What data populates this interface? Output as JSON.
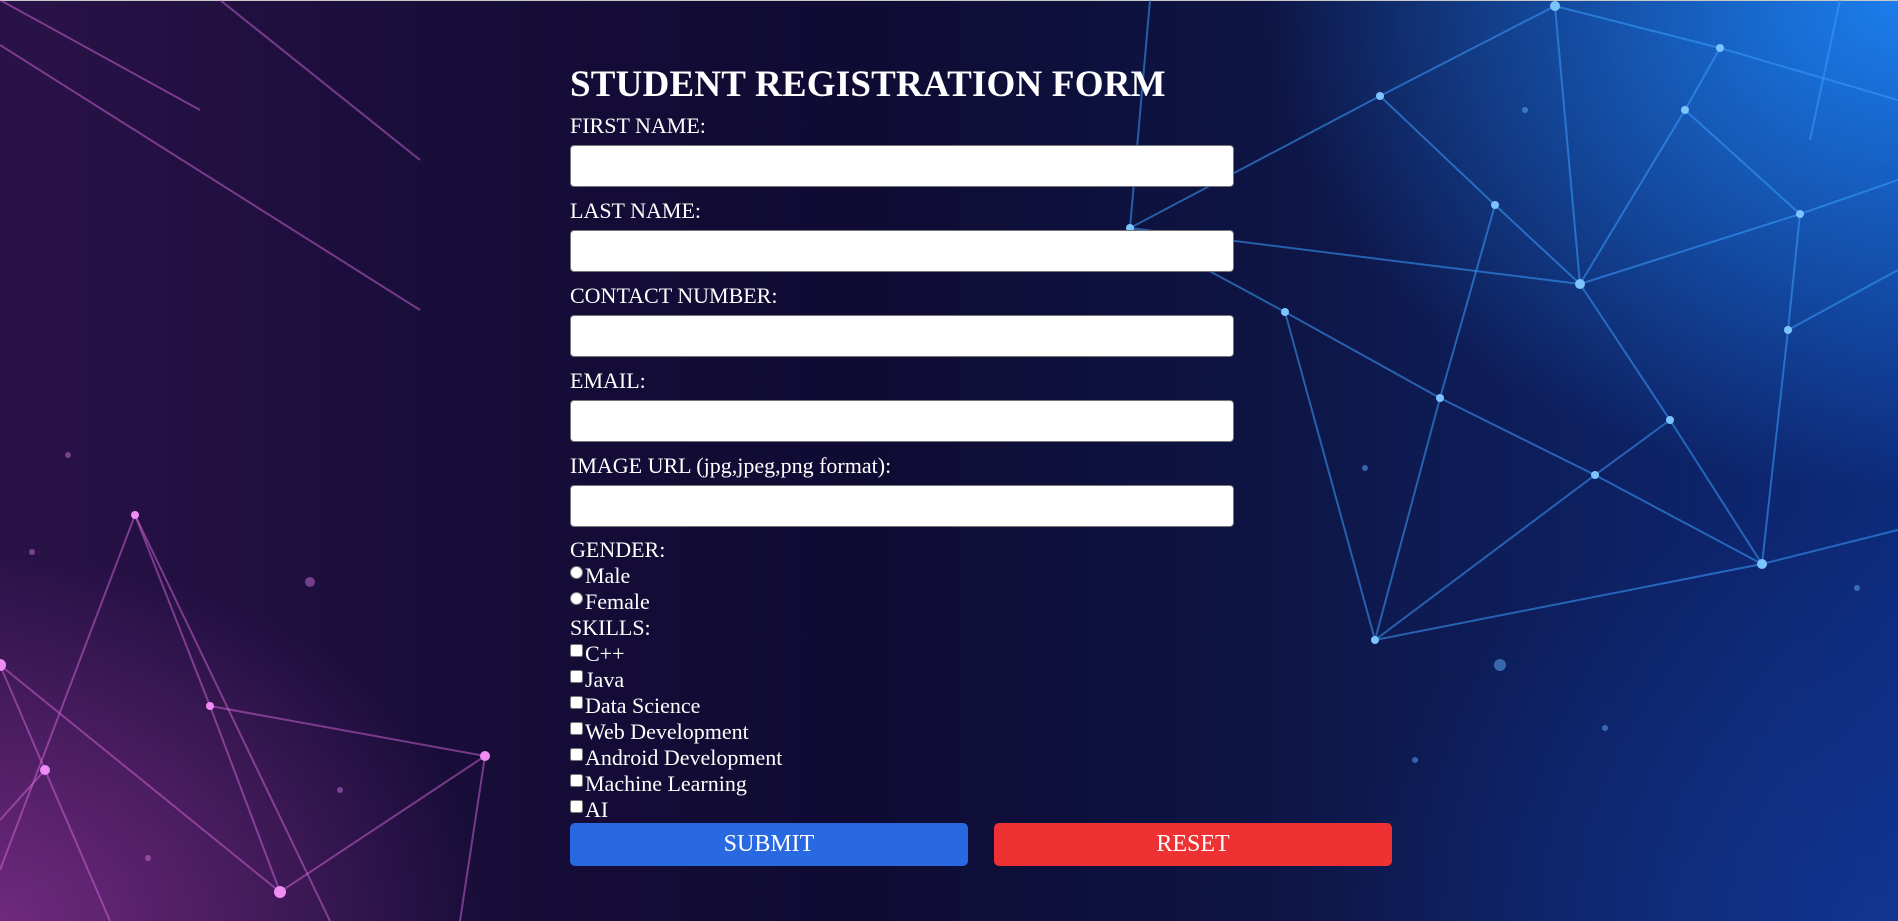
{
  "form": {
    "title": "STUDENT REGISTRATION FORM",
    "fields": [
      {
        "label": "FIRST NAME:",
        "value": "",
        "placeholder": ""
      },
      {
        "label": "LAST NAME:",
        "value": "",
        "placeholder": ""
      },
      {
        "label": "CONTACT NUMBER:",
        "value": "",
        "placeholder": ""
      },
      {
        "label": "EMAIL:",
        "value": "",
        "placeholder": ""
      },
      {
        "label": "IMAGE URL (jpg,jpeg,png format):",
        "value": "",
        "placeholder": ""
      }
    ],
    "gender": {
      "label": "GENDER:",
      "options": [
        "Male",
        "Female"
      ],
      "selected": null
    },
    "skills": {
      "label": "SKILLS:",
      "options": [
        "C++",
        "Java",
        "Data Science",
        "Web Development",
        "Android Development",
        "Machine Learning",
        "AI"
      ],
      "checked": []
    },
    "buttons": {
      "submit_label": "SUBMIT",
      "reset_label": "RESET"
    }
  },
  "colors": {
    "submit_button": "#2868e0",
    "reset_button": "#ee3132",
    "background_left": "#2a1248",
    "background_right": "#0d2a7a",
    "text": "#ffffff"
  }
}
